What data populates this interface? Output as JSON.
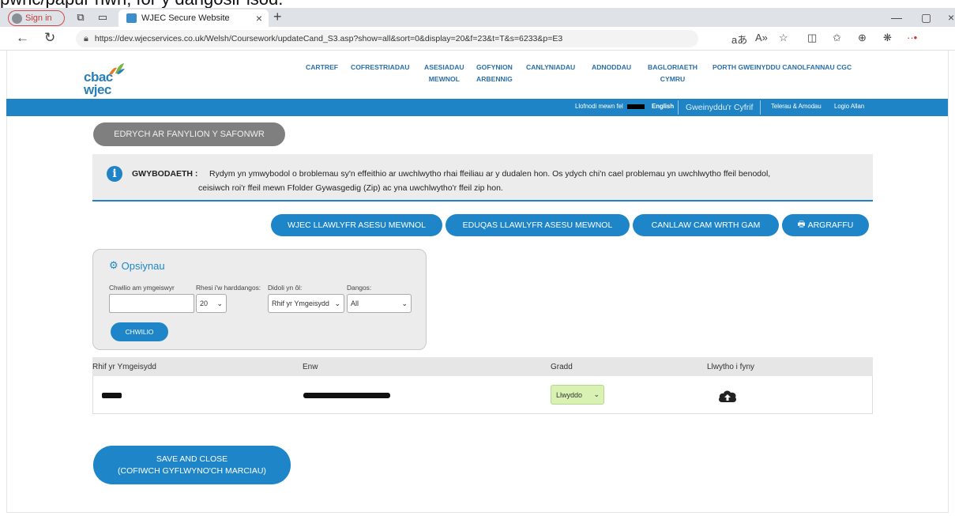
{
  "caption": "pwnc/papur hwn, for y dangosir isod.",
  "browser": {
    "signin_label": "Sign in",
    "tab_title": "WJEC Secure Website",
    "url": "https://dev.wjecservices.co.uk/Welsh/Coursework/updateCand_S3.asp?show=all&sort=0&display=20&f=23&t=T&s=6233&p=E3"
  },
  "site": {
    "logo_line1": "cbac",
    "logo_line2": "wjec",
    "nav": [
      {
        "line1": "CARTREF",
        "line2": ""
      },
      {
        "line1": "COFRESTRIADAU",
        "line2": ""
      },
      {
        "line1": "ASESIADAU",
        "line2": "MEWNOL"
      },
      {
        "line1": "GOFYNION",
        "line2": "ARBENNIG"
      },
      {
        "line1": "CANLYNIADAU",
        "line2": ""
      },
      {
        "line1": "ADNODDAU",
        "line2": ""
      },
      {
        "line1": "BAGLORIAETH",
        "line2": "CYMRU"
      },
      {
        "line1": "PORTH GWEINYDDU CANOLFANNAU CGC",
        "line2": ""
      }
    ],
    "userbar": {
      "logged_in_as": "Llofnodi mewn fel",
      "english": "English",
      "my_account": "Gweinyddu'r Cyfrif",
      "terms": "Telerau & Amodau",
      "logout": "Logio Allan"
    }
  },
  "page": {
    "view_details_button": "EDRYCH AR FANYLION Y SAFONWR",
    "info_label": "GWYBODAETH :",
    "info_line1": "Rydym yn ymwybodol o broblemau sy'n effeithio ar uwchlwytho rhai ffeiliau ar y dudalen hon. Os ydych chi'n cael problemau yn uwchlwytho ffeil benodol,",
    "info_line2": "ceisiwch roi'r ffeil mewn Ffolder Gywasgedig (Zip) ac yna uwchlwytho'r ffeil zip hon.",
    "buttons": {
      "wjec_manual": "WJEC LLAWLYFR ASESU MEWNOL",
      "eduqas_manual": "EDUQAS LLAWLYFR ASESU MEWNOL",
      "step_guide": "CANLLAW CAM WRTH GAM",
      "print": "ARGRAFFU"
    },
    "options": {
      "title": "Opsiynau",
      "search_label": "Chwilio am ymgeiswyr",
      "rows_label": "Rhesi i'w harddangos:",
      "sort_label": "Didoli yn ôl:",
      "show_label": "Dangos:",
      "rows_value": "20",
      "sort_value": "Rhif yr Ymgeisydd",
      "show_value": "All",
      "search_button": "CHWILIO"
    },
    "table": {
      "headers": [
        "Rhif yr Ymgeisydd",
        "Enw",
        "Gradd",
        "Llwytho i fyny"
      ],
      "rows": [
        {
          "grade": "Llwyddo"
        }
      ]
    },
    "save_line1": "SAVE AND CLOSE",
    "save_line2": "(COFIWCH GYFLWYNO'CH MARCIAU)"
  },
  "colors": {
    "brand_blue": "#1f84c5",
    "grade_green": "#d9f2b4",
    "disabled_grey": "#7f7f7f"
  }
}
